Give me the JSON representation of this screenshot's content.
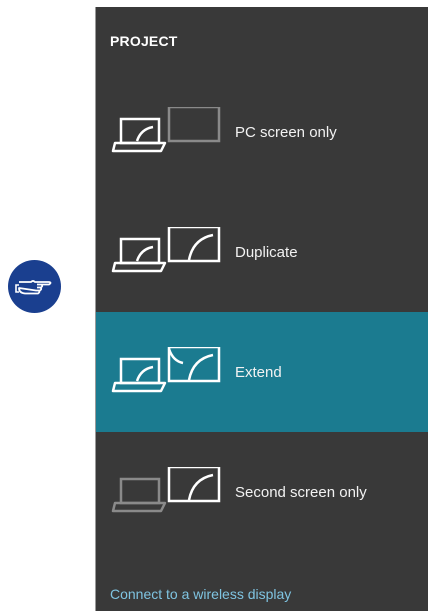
{
  "panel": {
    "title": "PROJECT",
    "options": [
      {
        "label": "PC screen only",
        "selected": false,
        "icon": "pc-screen-only-icon"
      },
      {
        "label": "Duplicate",
        "selected": false,
        "icon": "duplicate-icon"
      },
      {
        "label": "Extend",
        "selected": true,
        "icon": "extend-icon"
      },
      {
        "label": "Second screen only",
        "selected": false,
        "icon": "second-screen-only-icon"
      }
    ],
    "wireless_link": "Connect to a wireless display"
  },
  "colors": {
    "panel_bg": "#393939",
    "selected_bg": "#1b7b90",
    "link": "#7fc4e1",
    "hint_icon_bg": "#1a3f8f"
  }
}
